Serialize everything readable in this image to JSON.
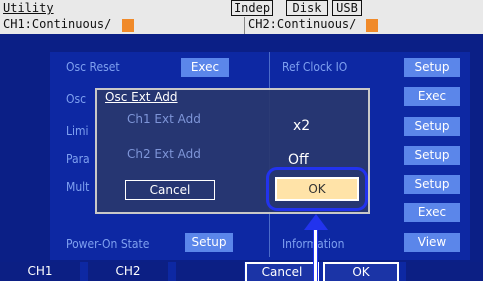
{
  "header": {
    "title": "Utility",
    "mode": "Indep",
    "disk": "Disk",
    "usb": "USB",
    "ch1_status": "CH1:Continuous/",
    "ch2_status": "CH2:Continuous/",
    "accent_color": "#f08a2a"
  },
  "menu": {
    "osc_reset_label": "Osc Reset",
    "osc_reset_button": "Exec",
    "osc_label": "Osc",
    "limit_label": "Limi",
    "param_label": "Para",
    "mult_label": "Mult",
    "power_on_label": "Power-On State",
    "power_on_button": "Setup",
    "ref_clock_label": "Ref Clock IO",
    "ref_clock_button": "Setup",
    "right_buttons": [
      "Exec",
      "Setup",
      "Setup",
      "Setup",
      "Exec"
    ],
    "information_label": "Information",
    "information_button": "View"
  },
  "dialog": {
    "title": "Osc Ext Add",
    "ch1_label": "Ch1 Ext Add",
    "ch1_value": "x2",
    "ch2_label": "Ch2 Ext Add",
    "ch2_value": "Off",
    "cancel_label": "Cancel",
    "ok_label": "OK"
  },
  "softkeys": [
    "CH1",
    "CH2",
    "",
    "Cancel",
    "OK",
    ""
  ]
}
